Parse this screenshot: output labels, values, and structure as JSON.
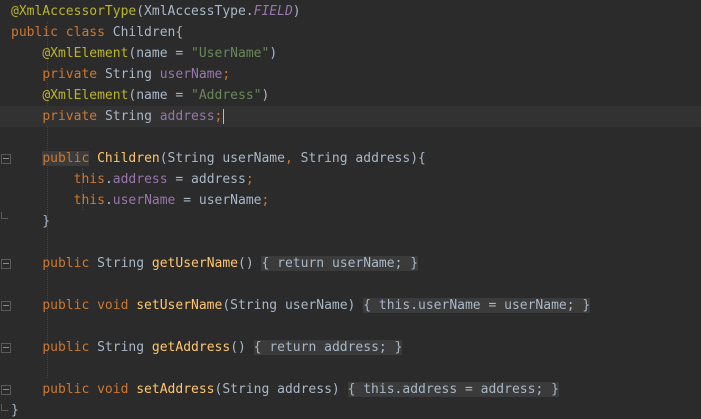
{
  "editor": {
    "language": "Java",
    "theme_colors": {
      "background": "#2b2b2b",
      "keyword": "#cc7832",
      "annotation": "#bbb529",
      "string": "#6a8759",
      "field": "#9876aa",
      "method": "#ffc66d",
      "text": "#a9b7c6"
    },
    "lines": [
      {
        "t": [
          {
            "k": "ann",
            "v": "@XmlAccessorType"
          },
          {
            "k": "txt",
            "v": "(XmlAccessType."
          },
          {
            "k": "fldi",
            "v": "FIELD"
          },
          {
            "k": "txt",
            "v": ")"
          }
        ]
      },
      {
        "t": [
          {
            "k": "kw",
            "v": "public class "
          },
          {
            "k": "txt",
            "v": "Children{"
          }
        ]
      },
      {
        "t": [
          {
            "k": "txt",
            "v": "    "
          },
          {
            "k": "ann",
            "v": "@XmlElement"
          },
          {
            "k": "txt",
            "v": "(name = "
          },
          {
            "k": "str",
            "v": "\"UserName\""
          },
          {
            "k": "txt",
            "v": ")"
          }
        ]
      },
      {
        "t": [
          {
            "k": "txt",
            "v": "    "
          },
          {
            "k": "kw",
            "v": "private "
          },
          {
            "k": "txt",
            "v": "String "
          },
          {
            "k": "fld",
            "v": "userName"
          },
          {
            "k": "kw",
            "v": ";"
          }
        ]
      },
      {
        "t": [
          {
            "k": "txt",
            "v": "    "
          },
          {
            "k": "ann",
            "v": "@XmlElement"
          },
          {
            "k": "txt",
            "v": "(name = "
          },
          {
            "k": "str",
            "v": "\"Address\""
          },
          {
            "k": "txt",
            "v": ")"
          }
        ]
      },
      {
        "current": true,
        "caret": true,
        "t": [
          {
            "k": "txt",
            "v": "    "
          },
          {
            "k": "kw",
            "v": "private "
          },
          {
            "k": "txt",
            "v": "String "
          },
          {
            "k": "fld",
            "v": "address"
          },
          {
            "k": "kw",
            "v": ";"
          }
        ]
      },
      {
        "t": []
      },
      {
        "t": [
          {
            "k": "txt",
            "v": "    "
          },
          {
            "k": "kw hl-match",
            "v": "public"
          },
          {
            "k": "txt",
            "v": " "
          },
          {
            "k": "fn",
            "v": "Children"
          },
          {
            "k": "txt",
            "v": "(String userName"
          },
          {
            "k": "kw",
            "v": ", "
          },
          {
            "k": "txt",
            "v": "String address){"
          }
        ]
      },
      {
        "t": [
          {
            "k": "txt",
            "v": "        "
          },
          {
            "k": "kw",
            "v": "this"
          },
          {
            "k": "txt",
            "v": "."
          },
          {
            "k": "fld",
            "v": "address"
          },
          {
            "k": "txt",
            "v": " = address"
          },
          {
            "k": "kw",
            "v": ";"
          }
        ]
      },
      {
        "t": [
          {
            "k": "txt",
            "v": "        "
          },
          {
            "k": "kw",
            "v": "this"
          },
          {
            "k": "txt",
            "v": "."
          },
          {
            "k": "fld",
            "v": "userName"
          },
          {
            "k": "txt",
            "v": " = userName"
          },
          {
            "k": "kw",
            "v": ";"
          }
        ]
      },
      {
        "t": [
          {
            "k": "txt",
            "v": "    }"
          }
        ]
      },
      {
        "t": []
      },
      {
        "t": [
          {
            "k": "txt",
            "v": "    "
          },
          {
            "k": "kw",
            "v": "public "
          },
          {
            "k": "txt",
            "v": "String "
          },
          {
            "k": "fn",
            "v": "getUserName"
          },
          {
            "k": "txt",
            "v": "() "
          },
          {
            "k": "fold-block",
            "v": "{ "
          },
          {
            "k": "kw fold-block",
            "v": "return "
          },
          {
            "k": "fld fold-block",
            "v": "userName"
          },
          {
            "k": "kw fold-block",
            "v": ";"
          },
          {
            "k": "fold-block",
            "v": " }"
          }
        ]
      },
      {
        "t": []
      },
      {
        "t": [
          {
            "k": "txt",
            "v": "    "
          },
          {
            "k": "kw",
            "v": "public void "
          },
          {
            "k": "fn",
            "v": "setUserName"
          },
          {
            "k": "txt",
            "v": "(String userName) "
          },
          {
            "k": "fold-block",
            "v": "{ "
          },
          {
            "k": "kw fold-block",
            "v": "this"
          },
          {
            "k": "fold-block",
            "v": "."
          },
          {
            "k": "fld fold-block",
            "v": "userName"
          },
          {
            "k": "fold-block",
            "v": " = userName"
          },
          {
            "k": "kw fold-block",
            "v": ";"
          },
          {
            "k": "fold-block",
            "v": " }"
          }
        ]
      },
      {
        "t": []
      },
      {
        "t": [
          {
            "k": "txt",
            "v": "    "
          },
          {
            "k": "kw",
            "v": "public "
          },
          {
            "k": "txt",
            "v": "String "
          },
          {
            "k": "fn",
            "v": "getAddress"
          },
          {
            "k": "txt",
            "v": "() "
          },
          {
            "k": "fold-block",
            "v": "{ "
          },
          {
            "k": "kw fold-block",
            "v": "return "
          },
          {
            "k": "fld fold-block",
            "v": "address"
          },
          {
            "k": "kw fold-block",
            "v": ";"
          },
          {
            "k": "fold-block",
            "v": " }"
          }
        ]
      },
      {
        "t": []
      },
      {
        "t": [
          {
            "k": "txt",
            "v": "    "
          },
          {
            "k": "kw",
            "v": "public void "
          },
          {
            "k": "fn",
            "v": "setAddress"
          },
          {
            "k": "txt",
            "v": "(String address) "
          },
          {
            "k": "fold-block",
            "v": "{ "
          },
          {
            "k": "kw fold-block",
            "v": "this"
          },
          {
            "k": "fold-block",
            "v": "."
          },
          {
            "k": "fld fold-block",
            "v": "address"
          },
          {
            "k": "fold-block",
            "v": " = address"
          },
          {
            "k": "kw fold-block",
            "v": ";"
          },
          {
            "k": "fold-block",
            "v": " }"
          }
        ]
      },
      {
        "t": [
          {
            "k": "txt",
            "v": "}"
          }
        ]
      }
    ]
  }
}
